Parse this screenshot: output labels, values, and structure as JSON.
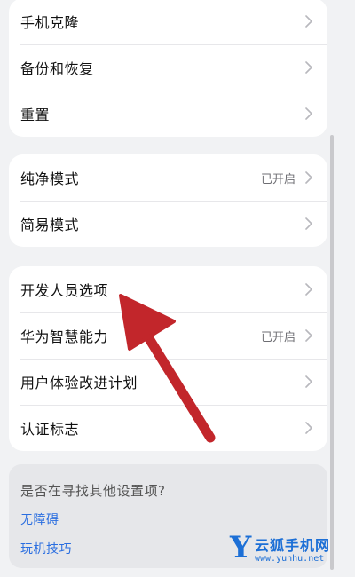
{
  "group1": {
    "items": [
      {
        "label": "手机克隆",
        "value": ""
      },
      {
        "label": "备份和恢复",
        "value": ""
      },
      {
        "label": "重置",
        "value": ""
      }
    ]
  },
  "group2": {
    "items": [
      {
        "label": "纯净模式",
        "value": "已开启"
      },
      {
        "label": "简易模式",
        "value": ""
      }
    ]
  },
  "group3": {
    "items": [
      {
        "label": "开发人员选项",
        "value": ""
      },
      {
        "label": "华为智慧能力",
        "value": "已开启"
      },
      {
        "label": "用户体验改进计划",
        "value": ""
      },
      {
        "label": "认证标志",
        "value": ""
      }
    ]
  },
  "suggestions": {
    "question": "是否在寻找其他设置项?",
    "links": [
      "无障碍",
      "玩机技巧"
    ]
  },
  "watermark": {
    "logo": "Y",
    "name": "云狐手机网",
    "url": "www.yunhu.net"
  },
  "colors": {
    "background": "#f1f2f4",
    "card": "#ffffff",
    "link": "#2a6ee0",
    "arrow": "#c2262b",
    "watermark": "#1c6fd6"
  },
  "icons": {
    "row_chevron": "chevron-right-icon",
    "annotation": "red-arrow"
  }
}
